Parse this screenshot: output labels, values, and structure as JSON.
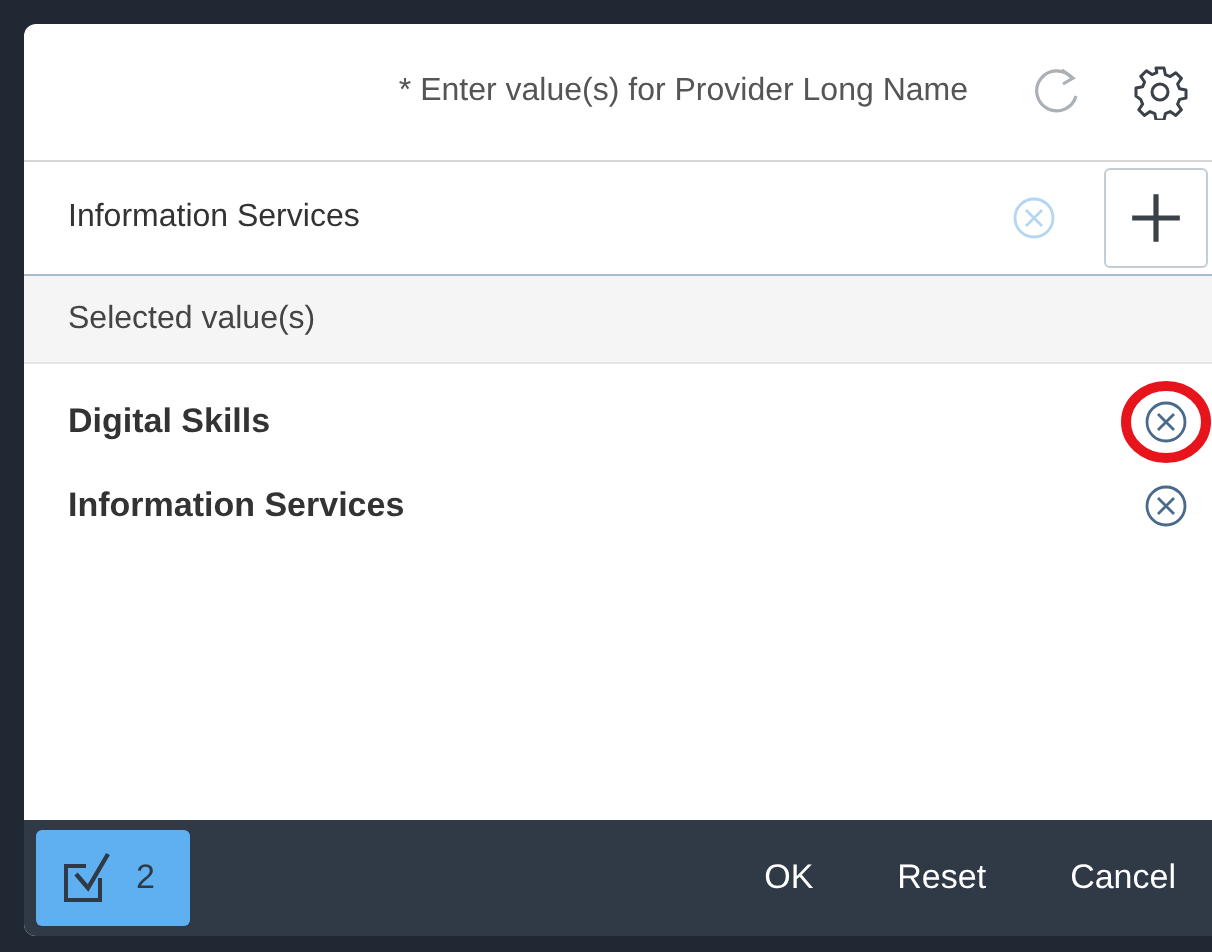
{
  "header": {
    "title": "* Enter value(s) for Provider Long Name"
  },
  "input": {
    "value": "Information Services"
  },
  "selected_section": {
    "title": "Selected value(s)"
  },
  "selected_values": [
    {
      "label": "Digital Skills",
      "highlighted": true
    },
    {
      "label": "Information Services",
      "highlighted": false
    }
  ],
  "footer": {
    "count": "2",
    "buttons": [
      "OK",
      "Reset",
      "Cancel"
    ]
  }
}
